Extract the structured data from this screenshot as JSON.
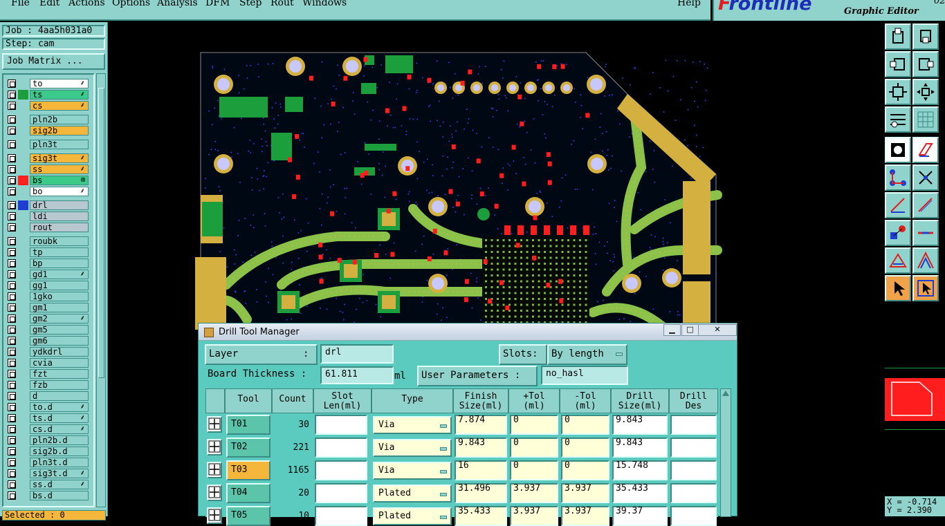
{
  "menu": {
    "items": [
      "File",
      "Edit",
      "Actions",
      "Options",
      "Analysis",
      "DFM",
      "Step",
      "Rout",
      "Windows"
    ],
    "help": "Help"
  },
  "logo": {
    "brand_first": "F",
    "brand_rest": "rontline",
    "subtitle": "Graphic Editor",
    "version": "02"
  },
  "job": {
    "job_label": "Job : 4aa5h031a0",
    "step_label": "Step: cam",
    "matrix_button": "Job Matrix ..."
  },
  "layers": [
    {
      "name": "to",
      "name_color": "#ffffff",
      "swatch": "",
      "mark": "⸙"
    },
    {
      "name": "ts",
      "name_color": "#3cc98a",
      "swatch": "#1c9e3c",
      "mark": "⸙"
    },
    {
      "name": "cs",
      "name_color": "#f5b63c",
      "swatch": "",
      "mark": "⸙"
    },
    {
      "name": "pln2b",
      "name_color": "#8fd3cc",
      "swatch": "",
      "mark": ""
    },
    {
      "name": "sig2b",
      "name_color": "#f5b63c",
      "swatch": "",
      "mark": ""
    },
    {
      "name": "pln3t",
      "name_color": "#8fd3cc",
      "swatch": "",
      "mark": ""
    },
    {
      "name": "sig3t",
      "name_color": "#f5b63c",
      "swatch": "",
      "mark": "⸙"
    },
    {
      "name": "ss",
      "name_color": "#f5b63c",
      "swatch": "",
      "mark": "⸙"
    },
    {
      "name": "bs",
      "name_color": "#3cc98a",
      "swatch": "#ff2020",
      "mark": "⊞"
    },
    {
      "name": "bo",
      "name_color": "#ffffff",
      "swatch": "",
      "mark": "⸙"
    },
    {
      "name": "drl",
      "name_color": "#b8c8d0",
      "swatch": "#1d3ed0",
      "mark": ""
    },
    {
      "name": "ldi",
      "name_color": "#b8c8d0",
      "swatch": "",
      "mark": ""
    },
    {
      "name": "rout",
      "name_color": "#b8c8d0",
      "swatch": "",
      "mark": ""
    },
    {
      "name": "roubk",
      "name_color": "#8fd3cc",
      "swatch": "",
      "mark": ""
    },
    {
      "name": "tp",
      "name_color": "#8fd3cc",
      "swatch": "",
      "mark": ""
    },
    {
      "name": "bp",
      "name_color": "#8fd3cc",
      "swatch": "",
      "mark": ""
    },
    {
      "name": "gd1",
      "name_color": "#8fd3cc",
      "swatch": "",
      "mark": "⸙"
    },
    {
      "name": "gg1",
      "name_color": "#8fd3cc",
      "swatch": "",
      "mark": ""
    },
    {
      "name": "1gko",
      "name_color": "#8fd3cc",
      "swatch": "",
      "mark": ""
    },
    {
      "name": "gm1",
      "name_color": "#8fd3cc",
      "swatch": "",
      "mark": ""
    },
    {
      "name": "gm2",
      "name_color": "#8fd3cc",
      "swatch": "",
      "mark": "⸙"
    },
    {
      "name": "gm5",
      "name_color": "#8fd3cc",
      "swatch": "",
      "mark": ""
    },
    {
      "name": "gm6",
      "name_color": "#8fd3cc",
      "swatch": "",
      "mark": ""
    },
    {
      "name": "ydkdrl",
      "name_color": "#8fd3cc",
      "swatch": "",
      "mark": ""
    },
    {
      "name": "cvia",
      "name_color": "#8fd3cc",
      "swatch": "",
      "mark": ""
    },
    {
      "name": "fzt",
      "name_color": "#8fd3cc",
      "swatch": "",
      "mark": ""
    },
    {
      "name": "fzb",
      "name_color": "#8fd3cc",
      "swatch": "",
      "mark": ""
    },
    {
      "name": "d",
      "name_color": "#8fd3cc",
      "swatch": "",
      "mark": ""
    },
    {
      "name": "to.d",
      "name_color": "#8fd3cc",
      "swatch": "",
      "mark": "⸙"
    },
    {
      "name": "ts.d",
      "name_color": "#8fd3cc",
      "swatch": "",
      "mark": "⸙"
    },
    {
      "name": "cs.d",
      "name_color": "#8fd3cc",
      "swatch": "",
      "mark": "⸙"
    },
    {
      "name": "pln2b.d",
      "name_color": "#8fd3cc",
      "swatch": "",
      "mark": ""
    },
    {
      "name": "sig2b.d",
      "name_color": "#8fd3cc",
      "swatch": "",
      "mark": ""
    },
    {
      "name": "pln3t.d",
      "name_color": "#8fd3cc",
      "swatch": "",
      "mark": ""
    },
    {
      "name": "sig3t.d",
      "name_color": "#8fd3cc",
      "swatch": "",
      "mark": "⸙"
    },
    {
      "name": "ss.d",
      "name_color": "#8fd3cc",
      "swatch": "",
      "mark": "⸙"
    },
    {
      "name": "bs.d",
      "name_color": "#8fd3cc",
      "swatch": "",
      "mark": ""
    }
  ],
  "status": {
    "selected": "Selected : 0",
    "x": "X = -0.714",
    "y": "Y = 2.390"
  },
  "dialog": {
    "title": "Drill Tool Manager",
    "layer_label": "Layer",
    "layer_colon": ":",
    "layer_value": "drl",
    "slots_label": "Slots:",
    "slots_value": "By length",
    "board_thickness_label": "Board Thickness :",
    "board_thickness_value": "61.811",
    "board_thickness_unit": "ml",
    "user_params_label": "User Parameters :",
    "user_params_value": "no_hasl",
    "columns": [
      "Tool",
      "Count",
      "Slot\nLen(ml)",
      "Type",
      "Finish\nSize(ml)",
      "+Tol\n(ml)",
      "-Tol\n(ml)",
      "Drill\nSize(ml)",
      "Drill\nDes"
    ],
    "rows": [
      {
        "tool": "T01",
        "count": "30",
        "slot": "",
        "type": "Via",
        "finish": "7.874",
        "ptol": "0",
        "mtol": "0",
        "drill": "9.843",
        "des": "",
        "selected": false
      },
      {
        "tool": "T02",
        "count": "221",
        "slot": "",
        "type": "Via",
        "finish": "9.843",
        "ptol": "0",
        "mtol": "0",
        "drill": "9.843",
        "des": "",
        "selected": false
      },
      {
        "tool": "T03",
        "count": "1165",
        "slot": "",
        "type": "Via",
        "finish": "16",
        "ptol": "0",
        "mtol": "0",
        "drill": "15.748",
        "des": "",
        "selected": true
      },
      {
        "tool": "T04",
        "count": "20",
        "slot": "",
        "type": "Plated",
        "finish": "31.496",
        "ptol": "3.937",
        "mtol": "3.937",
        "drill": "35.433",
        "des": "",
        "selected": false
      },
      {
        "tool": "T05",
        "count": "10",
        "slot": "",
        "type": "Plated",
        "finish": "35.433",
        "ptol": "3.937",
        "mtol": "3.937",
        "drill": "39.37",
        "des": "",
        "selected": false
      }
    ]
  }
}
